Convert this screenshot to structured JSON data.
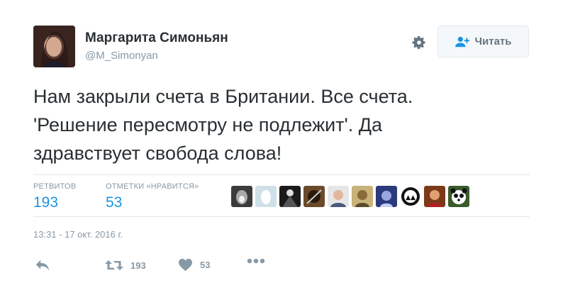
{
  "author": {
    "name": "Маргарита Симоньян",
    "handle": "@M_Simonyan",
    "avatar_icon": "user-avatar"
  },
  "header": {
    "settings_icon": "gear-icon",
    "follow_icon": "add-user-icon",
    "follow_label": "Читать"
  },
  "tweet": {
    "lines": [
      "Нам закрыли счета в Британии. Все счета.",
      "'Решение пересмотру не подлежит'. Да",
      "здравствует свобода слова!"
    ]
  },
  "stats": {
    "retweets_label": "РЕТВИТОВ",
    "retweets_value": "193",
    "likes_label": "ОТМЕТКИ «НРАВИТСЯ»",
    "likes_value": "53",
    "likers_count_shown": 10
  },
  "timestamp": "13:31 - 17 окт. 2016 г.",
  "actions": {
    "reply_icon": "reply-icon",
    "retweet_icon": "retweet-icon",
    "retweet_count": "193",
    "like_icon": "heart-icon",
    "like_count": "53",
    "more_icon": "more-icon"
  },
  "colors": {
    "accent": "#1b95e0",
    "muted": "#8899a6",
    "text": "#292f33",
    "border": "#e1e8ed"
  }
}
